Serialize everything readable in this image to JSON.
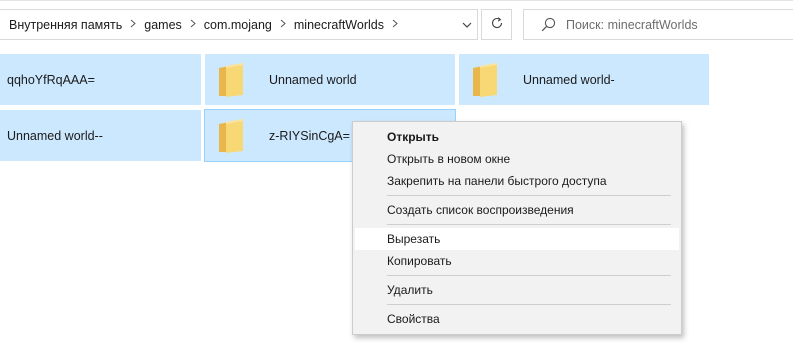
{
  "breadcrumb": [
    "Внутренняя память",
    "games",
    "com.mojang",
    "minecraftWorlds"
  ],
  "search": {
    "placeholder": "Поиск: minecraftWorlds"
  },
  "folders": [
    {
      "name": "qqhoYfRqAAA="
    },
    {
      "name": "Unnamed world"
    },
    {
      "name": "Unnamed world-"
    },
    {
      "name": "Unnamed world--"
    },
    {
      "name": "z-RIYSinCgA="
    }
  ],
  "context_menu": {
    "items": [
      {
        "label": "Открыть"
      },
      {
        "label": "Открыть в новом окне"
      },
      {
        "label": "Закрепить на панели быстрого доступа"
      },
      {
        "label": "Создать список воспроизведения"
      },
      {
        "label": "Вырезать"
      },
      {
        "label": "Копировать"
      },
      {
        "label": "Удалить"
      },
      {
        "label": "Свойства"
      }
    ]
  },
  "colors": {
    "selection": "#cce8ff",
    "menu_bg": "#f2f2f2",
    "folder": "#f8d775"
  },
  "icons": [
    "chevron-right-icon",
    "chevron-down-icon",
    "refresh-icon",
    "search-icon",
    "folder-icon"
  ]
}
